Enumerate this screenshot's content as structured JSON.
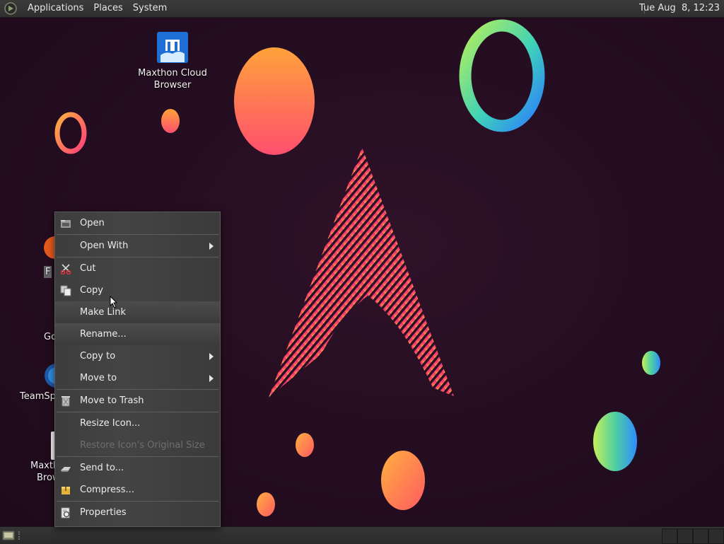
{
  "top_panel": {
    "menus": [
      "Applications",
      "Places",
      "System"
    ],
    "clock": "Tue Aug  8, 12:23"
  },
  "desktop_icons": [
    {
      "label_line1": "Maxthon Cloud",
      "label_line2": "Browser",
      "icon": "maxthon-browser-icon"
    },
    {
      "label": "F",
      "icon": "firefox-icon"
    },
    {
      "label": "Go",
      "icon": "chrome-icon"
    },
    {
      "label": "TeamSp",
      "icon": "teamspeak-icon"
    },
    {
      "label_line1": "Maxth",
      "label_line2": "Brow",
      "icon": "maxthon-browser-icon"
    }
  ],
  "context_menu": {
    "items": [
      {
        "label": "Open",
        "icon": "open-folder-icon",
        "submenu": false,
        "enabled": true
      },
      {
        "label": "Open With",
        "icon": "",
        "submenu": true,
        "enabled": true
      },
      {
        "label": "Cut",
        "icon": "scissors-icon",
        "submenu": false,
        "enabled": true
      },
      {
        "label": "Copy",
        "icon": "copy-icon",
        "submenu": false,
        "enabled": true
      },
      {
        "label": "Make Link",
        "icon": "",
        "submenu": false,
        "enabled": true,
        "hovered": true
      },
      {
        "label": "Rename...",
        "icon": "",
        "submenu": false,
        "enabled": true
      },
      {
        "label": "Copy to",
        "icon": "",
        "submenu": true,
        "enabled": true
      },
      {
        "label": "Move to",
        "icon": "",
        "submenu": true,
        "enabled": true
      },
      {
        "label": "Move to Trash",
        "icon": "trash-icon",
        "submenu": false,
        "enabled": true
      },
      {
        "label": "Resize Icon...",
        "icon": "",
        "submenu": false,
        "enabled": true
      },
      {
        "label": "Restore Icon's Original Size",
        "icon": "",
        "submenu": false,
        "enabled": false
      },
      {
        "label": "Send to...",
        "icon": "send-icon",
        "submenu": false,
        "enabled": true
      },
      {
        "label": "Compress...",
        "icon": "archive-icon",
        "submenu": false,
        "enabled": true
      },
      {
        "label": "Properties",
        "icon": "properties-icon",
        "submenu": false,
        "enabled": true
      }
    ]
  },
  "colors": {
    "background": "#260f22",
    "arch_logo": "#e0307a",
    "menu_bg": "#404040",
    "panel_bg": "#333333"
  }
}
